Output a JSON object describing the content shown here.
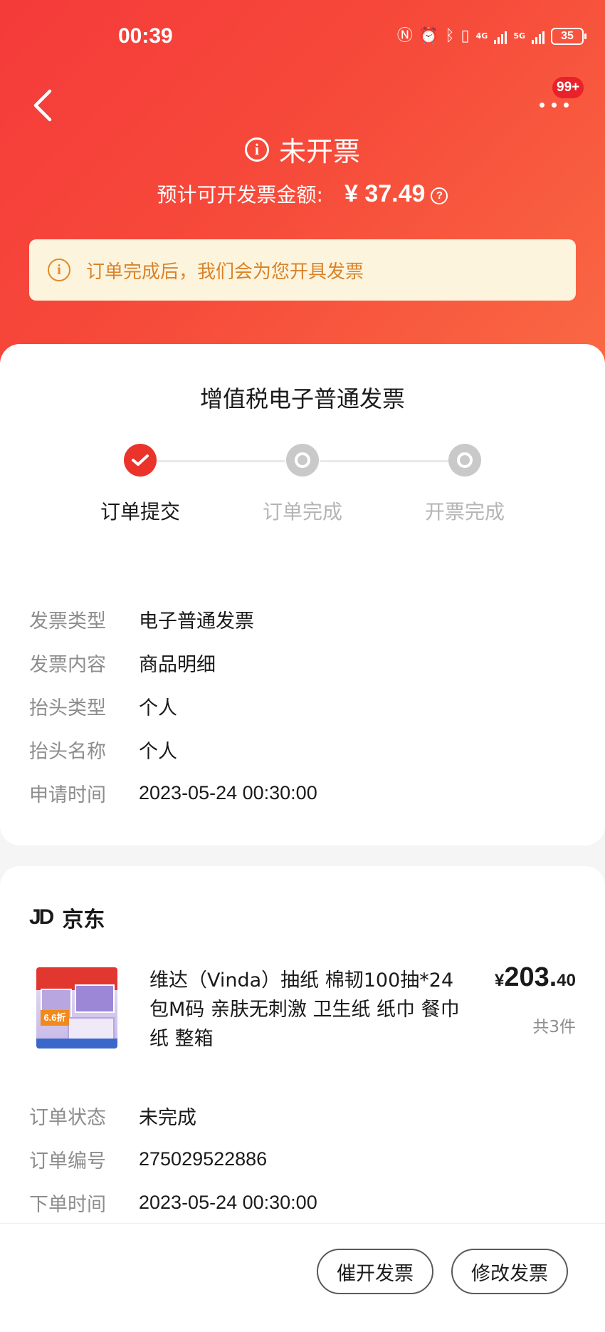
{
  "status_bar": {
    "time": "00:39",
    "battery": "35",
    "net_4g": "4G",
    "net_5g": "5G"
  },
  "nav": {
    "back_icon": "chevron-left-icon",
    "more_icon": "more-dots-icon",
    "badge": "99+"
  },
  "invoice_status": {
    "title": "未开票",
    "amount_label": "预计可开发票金额:",
    "amount_value": "¥ 37.49"
  },
  "notice": {
    "text": "订单完成后，我们会为您开具发票"
  },
  "invoice": {
    "card_title": "增值税电子普通发票",
    "steps": [
      {
        "label": "订单提交",
        "done": true
      },
      {
        "label": "订单完成",
        "done": false
      },
      {
        "label": "开票完成",
        "done": false
      }
    ],
    "details": [
      {
        "key": "发票类型",
        "value": "电子普通发票"
      },
      {
        "key": "发票内容",
        "value": "商品明细"
      },
      {
        "key": "抬头类型",
        "value": "个人"
      },
      {
        "key": "抬头名称",
        "value": "个人"
      },
      {
        "key": "申请时间",
        "value": "2023-05-24 00:30:00"
      }
    ]
  },
  "order": {
    "shop_logo": "JD",
    "shop_name": "京东",
    "product_title": "维达（Vinda）抽纸 棉韧100抽*24包M码 亲肤无刺激 卫生纸 纸巾 餐巾纸 整箱",
    "product_image_tag": "6.6折",
    "price_currency": "¥",
    "price_int": "203.",
    "price_dec": "40",
    "quantity": "共3件",
    "details": [
      {
        "key": "订单状态",
        "value": "未完成"
      },
      {
        "key": "订单编号",
        "value": "275029522886"
      },
      {
        "key": "下单时间",
        "value": "2023-05-24 00:30:00"
      }
    ]
  },
  "actions": {
    "urge_label": "催开发票",
    "modify_label": "修改发票"
  },
  "colors": {
    "header_red": "#f53a3a",
    "accent_red": "#e9332b",
    "notice_bg": "#fdf4dd",
    "notice_text": "#d9832a"
  }
}
